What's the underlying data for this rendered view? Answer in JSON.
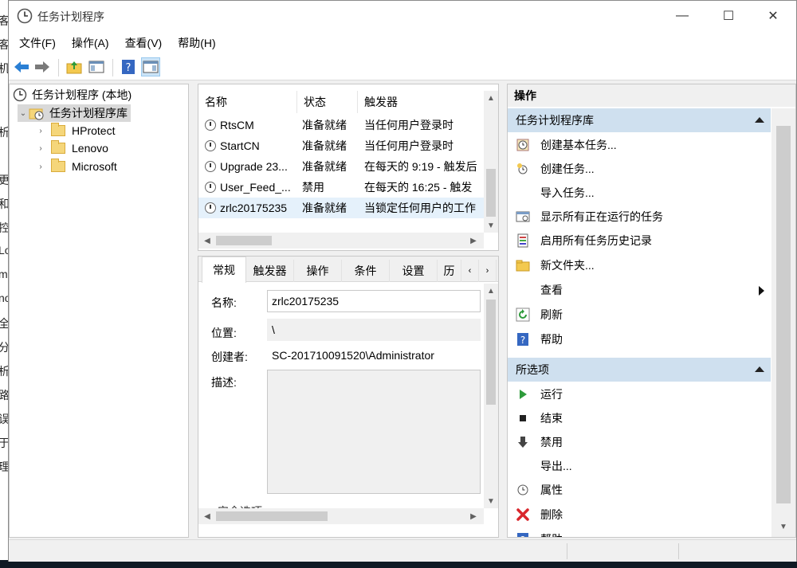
{
  "window": {
    "title": "任务计划程序",
    "minimize": "—",
    "maximize": "☐",
    "close": "✕"
  },
  "menu": [
    "文件(F)",
    "操作(A)",
    "查看(V)",
    "帮助(H)"
  ],
  "bg_left_chars": [
    "客",
    "客",
    "机",
    "",
    "析",
    "",
    "",
    "更",
    "和",
    "控",
    "Lo",
    "m",
    "no",
    "全",
    "分",
    "析",
    "路",
    "误",
    "于",
    "理"
  ],
  "tree": {
    "root": "任务计划程序 (本地)",
    "library": "任务计划程序库",
    "children": [
      "HProtect",
      "Lenovo",
      "Microsoft"
    ]
  },
  "tasks": {
    "columns": [
      "名称",
      "状态",
      "触发器"
    ],
    "rows": [
      {
        "name": "RtsCM",
        "status": "准备就绪",
        "trigger": "当任何用户登录时"
      },
      {
        "name": "StartCN",
        "status": "准备就绪",
        "trigger": "当任何用户登录时"
      },
      {
        "name": "Upgrade 23...",
        "status": "准备就绪",
        "trigger": "在每天的 9:19 - 触发后"
      },
      {
        "name": "User_Feed_...",
        "status": "禁用",
        "trigger": "在每天的 16:25 - 触发"
      },
      {
        "name": "zrlc20175235",
        "status": "准备就绪",
        "trigger": "当锁定任何用户的工作"
      }
    ]
  },
  "details": {
    "tabs": [
      "常规",
      "触发器",
      "操作",
      "条件",
      "设置",
      "历"
    ],
    "name_label": "名称:",
    "name_value": "zrlc20175235",
    "location_label": "位置:",
    "location_value": "\\",
    "author_label": "创建者:",
    "author_value": "SC-201710091520\\Administrator",
    "desc_label": "描述:",
    "security_label": "安全选项"
  },
  "actions": {
    "header": "操作",
    "section1": "任务计划程序库",
    "items1": [
      "创建基本任务...",
      "创建任务...",
      "导入任务...",
      "显示所有正在运行的任务",
      "启用所有任务历史记录",
      "新文件夹...",
      "查看",
      "刷新",
      "帮助"
    ],
    "section2": "所选项",
    "items2": [
      "运行",
      "结束",
      "禁用",
      "导出...",
      "属性",
      "删除",
      "帮助"
    ]
  },
  "colors": {
    "section_bg": "#cfe0ef",
    "selection": "#e5f1fb",
    "accent": "#0078d7"
  }
}
